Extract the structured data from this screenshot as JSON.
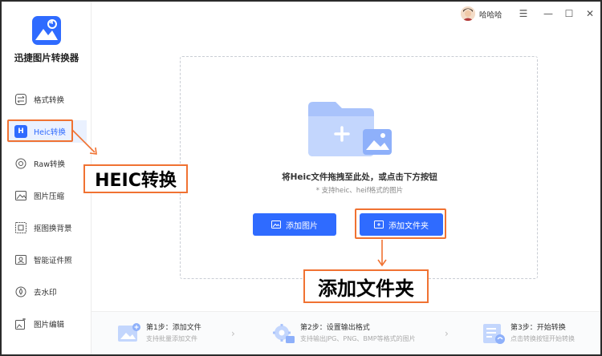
{
  "app": {
    "title": "迅捷图片转换器"
  },
  "user": {
    "name": "哈哈哈"
  },
  "window_controls": {
    "menu": "☰",
    "minimize": "—",
    "maximize": "☐",
    "close": "✕"
  },
  "sidebar": {
    "items": [
      {
        "label": "格式转换",
        "icon": "swap-icon"
      },
      {
        "label": "Heic转换",
        "icon": "heic-icon",
        "badge": "H"
      },
      {
        "label": "Raw转换",
        "icon": "raw-icon"
      },
      {
        "label": "图片压缩",
        "icon": "compress-icon"
      },
      {
        "label": "抠图换背景",
        "icon": "cutout-icon"
      },
      {
        "label": "智能证件照",
        "icon": "id-photo-icon"
      },
      {
        "label": "去水印",
        "icon": "watermark-icon"
      },
      {
        "label": "图片编辑",
        "icon": "edit-icon"
      }
    ]
  },
  "dropzone": {
    "title": "将Heic文件拖拽至此处，或点击下方按钮",
    "hint": "* 支持heic、heif格式的图片",
    "add_image_label": "添加图片",
    "add_folder_label": "添加文件夹"
  },
  "steps": [
    {
      "title": "第1步：添加文件",
      "desc": "支持批量添加文件"
    },
    {
      "title": "第2步：设置输出格式",
      "desc": "支持输出JPG、PNG、BMP等格式的图片"
    },
    {
      "title": "第3步：开始转换",
      "desc": "点击转换按钮开始转换"
    }
  ],
  "annotations": {
    "heic_label": "HEIC转换",
    "folder_label": "添加文件夹"
  },
  "colors": {
    "accent": "#2f6bff",
    "annotation": "#f07232"
  }
}
